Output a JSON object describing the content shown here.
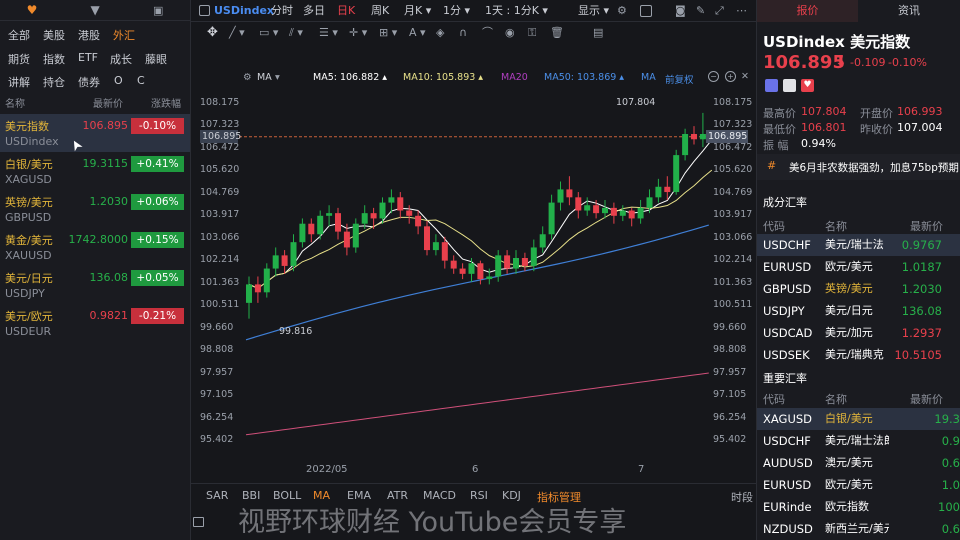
{
  "left": {
    "categories_row1": [
      "全部",
      "美股",
      "港股",
      "外汇"
    ],
    "categories_row2": [
      "期货",
      "指数",
      "ETF",
      "成长",
      "藤眼"
    ],
    "categories_row3": [
      "讲解",
      "持仓",
      "债券",
      "O",
      "C"
    ],
    "active_category": "外汇",
    "headers": {
      "name": "名称",
      "price": "最新价",
      "change": "涨跌幅"
    },
    "rows": [
      {
        "name": "美元指数",
        "code": "USDindex",
        "price": "106.895",
        "change": "-0.10%",
        "dir": "down"
      },
      {
        "name": "白银/美元",
        "code": "XAGUSD",
        "price": "19.3115",
        "change": "+0.41%",
        "dir": "up"
      },
      {
        "name": "英镑/美元",
        "code": "GBPUSD",
        "price": "1.2030",
        "change": "+0.06%",
        "dir": "up"
      },
      {
        "name": "黄金/美元",
        "code": "XAUUSD",
        "price": "1742.8000",
        "change": "+0.15%",
        "dir": "up"
      },
      {
        "name": "美元/日元",
        "code": "USDJPY",
        "price": "136.08",
        "change": "+0.05%",
        "dir": "up"
      },
      {
        "name": "美元/欧元",
        "code": "USDEUR",
        "price": "0.9821",
        "change": "-0.21%",
        "dir": "down"
      }
    ]
  },
  "toolbar": {
    "symbol": "USDindex",
    "periods": [
      "分时",
      "多日",
      "日K",
      "周K",
      "月K ▾",
      "1分 ▾",
      "1天 : 1分K ▾"
    ],
    "active_period": "日K",
    "display": "显示 ▾"
  },
  "ma_legend": {
    "ma": "MA",
    "ma5": "MA5: 106.882 ▴",
    "ma10": "MA10: 105.893 ▴",
    "ma20": "MA20",
    "ma50": "MA50: 103.869 ▴",
    "ma_other": "MA",
    "adjust": "前复权"
  },
  "y_ticks": [
    "108.175",
    "107.323",
    "106.472",
    "105.620",
    "104.769",
    "103.917",
    "103.066",
    "102.214",
    "101.363",
    "100.511",
    "99.660",
    "98.808",
    "97.957",
    "97.105",
    "96.254",
    "95.402"
  ],
  "current_price_tag": "106.895",
  "left_price_tag": "106.895",
  "high_label": "107.804",
  "low_label": "99.816",
  "x_ticks": [
    "2022/05",
    "6",
    "7"
  ],
  "indicators": [
    "SAR",
    "BBI",
    "BOLL",
    "MA",
    "EMA",
    "ATR",
    "MACD",
    "RSI",
    "KDJ",
    "指标管理"
  ],
  "active_indicator": "MA",
  "timeshare": "时段",
  "watermark": "视野环球财经 YouTube会员专享",
  "right": {
    "tabs": [
      "报价",
      "资讯"
    ],
    "title": "USDindex 美元指数",
    "price": "106.895",
    "change": "-0.109",
    "change_pct": "-0.10%",
    "high_label": "最高价",
    "high": "107.804",
    "open_label": "开盘价",
    "open": "106.993",
    "low_label": "最低价",
    "low": "106.801",
    "prev_label": "昨收价",
    "prev": "107.004",
    "amp_label": "振 幅",
    "amp": "0.94%",
    "news": "美6月非农数据强劲，加息75bp预期",
    "section1": "成分汇率",
    "section2": "重要汇率",
    "col_code": "代码",
    "col_name": "名称",
    "col_price": "最新价",
    "rates1": [
      {
        "code": "USDCHF",
        "name": "美元/瑞士法",
        "price": "0.9767",
        "dir": "up"
      },
      {
        "code": "EURUSD",
        "name": "欧元/美元",
        "price": "1.0187",
        "dir": "up"
      },
      {
        "code": "GBPUSD",
        "name": "英镑/美元",
        "price": "1.2030",
        "dir": "up"
      },
      {
        "code": "USDJPY",
        "name": "美元/日元",
        "price": "136.08",
        "dir": "up"
      },
      {
        "code": "USDCAD",
        "name": "美元/加元",
        "price": "1.2937",
        "dir": "down"
      },
      {
        "code": "USDSEK",
        "name": "美元/瑞典克",
        "price": "10.5105",
        "dir": "down"
      }
    ],
    "rates2": [
      {
        "code": "XAGUSD",
        "name": "白银/美元",
        "price": "19.3",
        "dir": "up"
      },
      {
        "code": "USDCHF",
        "name": "美元/瑞士法郎",
        "price": "0.9",
        "dir": "up"
      },
      {
        "code": "AUDUSD",
        "name": "澳元/美元",
        "price": "0.6",
        "dir": "up"
      },
      {
        "code": "EURUSD",
        "name": "欧元/美元",
        "price": "1.0",
        "dir": "up"
      },
      {
        "code": "EURinde",
        "name": "欧元指数",
        "price": "100",
        "dir": "up"
      },
      {
        "code": "NZDUSD",
        "name": "新西兰元/美元",
        "price": "0.6",
        "dir": "up"
      }
    ]
  },
  "chart_data": {
    "type": "candlestick",
    "ylim": [
      95.402,
      108.175
    ],
    "candles": [
      [
        100.6,
        101.3,
        100.0,
        101.6
      ],
      [
        101.3,
        101.0,
        100.6,
        101.6
      ],
      [
        101.0,
        101.9,
        100.8,
        102.1
      ],
      [
        101.9,
        102.4,
        101.6,
        102.7
      ],
      [
        102.4,
        102.0,
        101.7,
        102.6
      ],
      [
        102.0,
        102.9,
        101.8,
        103.2
      ],
      [
        102.9,
        103.6,
        102.7,
        103.8
      ],
      [
        103.6,
        103.2,
        102.9,
        103.8
      ],
      [
        103.2,
        103.9,
        103.0,
        104.1
      ],
      [
        103.9,
        104.0,
        103.5,
        104.3
      ],
      [
        104.0,
        103.3,
        103.0,
        104.2
      ],
      [
        103.3,
        102.7,
        102.4,
        103.6
      ],
      [
        102.7,
        103.6,
        102.5,
        103.8
      ],
      [
        103.6,
        104.0,
        103.4,
        104.3
      ],
      [
        104.0,
        103.8,
        103.4,
        104.2
      ],
      [
        103.8,
        104.4,
        103.6,
        104.6
      ],
      [
        104.4,
        104.6,
        104.0,
        104.9
      ],
      [
        104.6,
        104.1,
        103.8,
        104.8
      ],
      [
        104.1,
        103.9,
        103.6,
        104.3
      ],
      [
        103.9,
        103.5,
        103.2,
        104.1
      ],
      [
        103.5,
        102.6,
        102.4,
        103.7
      ],
      [
        102.6,
        102.9,
        102.4,
        103.2
      ],
      [
        102.9,
        102.2,
        101.9,
        103.1
      ],
      [
        102.2,
        101.9,
        101.7,
        102.4
      ],
      [
        101.9,
        101.7,
        101.5,
        102.1
      ],
      [
        101.7,
        102.1,
        101.4,
        102.3
      ],
      [
        102.1,
        101.5,
        101.3,
        102.2
      ],
      [
        101.5,
        101.6,
        101.3,
        101.9
      ],
      [
        101.6,
        102.4,
        101.4,
        102.6
      ],
      [
        102.4,
        101.9,
        101.7,
        102.6
      ],
      [
        101.9,
        102.3,
        101.7,
        102.6
      ],
      [
        102.3,
        102.0,
        101.8,
        102.5
      ],
      [
        102.0,
        102.7,
        101.8,
        103.0
      ],
      [
        102.7,
        103.2,
        102.5,
        103.5
      ],
      [
        103.2,
        104.4,
        103.0,
        104.7
      ],
      [
        104.4,
        104.9,
        104.1,
        105.2
      ],
      [
        104.9,
        104.6,
        104.3,
        105.4
      ],
      [
        104.6,
        104.1,
        103.8,
        104.8
      ],
      [
        104.1,
        104.3,
        103.9,
        104.6
      ],
      [
        104.3,
        104.0,
        103.8,
        104.5
      ],
      [
        104.0,
        104.2,
        103.8,
        104.5
      ],
      [
        104.2,
        103.9,
        103.6,
        104.4
      ],
      [
        103.9,
        104.1,
        103.7,
        104.3
      ],
      [
        104.1,
        103.8,
        103.5,
        104.2
      ],
      [
        103.8,
        104.2,
        103.6,
        104.5
      ],
      [
        104.2,
        104.6,
        104.0,
        104.9
      ],
      [
        104.6,
        105.0,
        104.4,
        105.3
      ],
      [
        105.0,
        104.8,
        104.5,
        105.4
      ],
      [
        104.8,
        106.2,
        104.7,
        106.4
      ],
      [
        106.2,
        107.0,
        106.0,
        107.2
      ],
      [
        107.0,
        106.8,
        106.6,
        107.3
      ],
      [
        106.8,
        107.0,
        106.5,
        107.8
      ],
      [
        107.0,
        106.9,
        106.7,
        107.1
      ]
    ]
  }
}
